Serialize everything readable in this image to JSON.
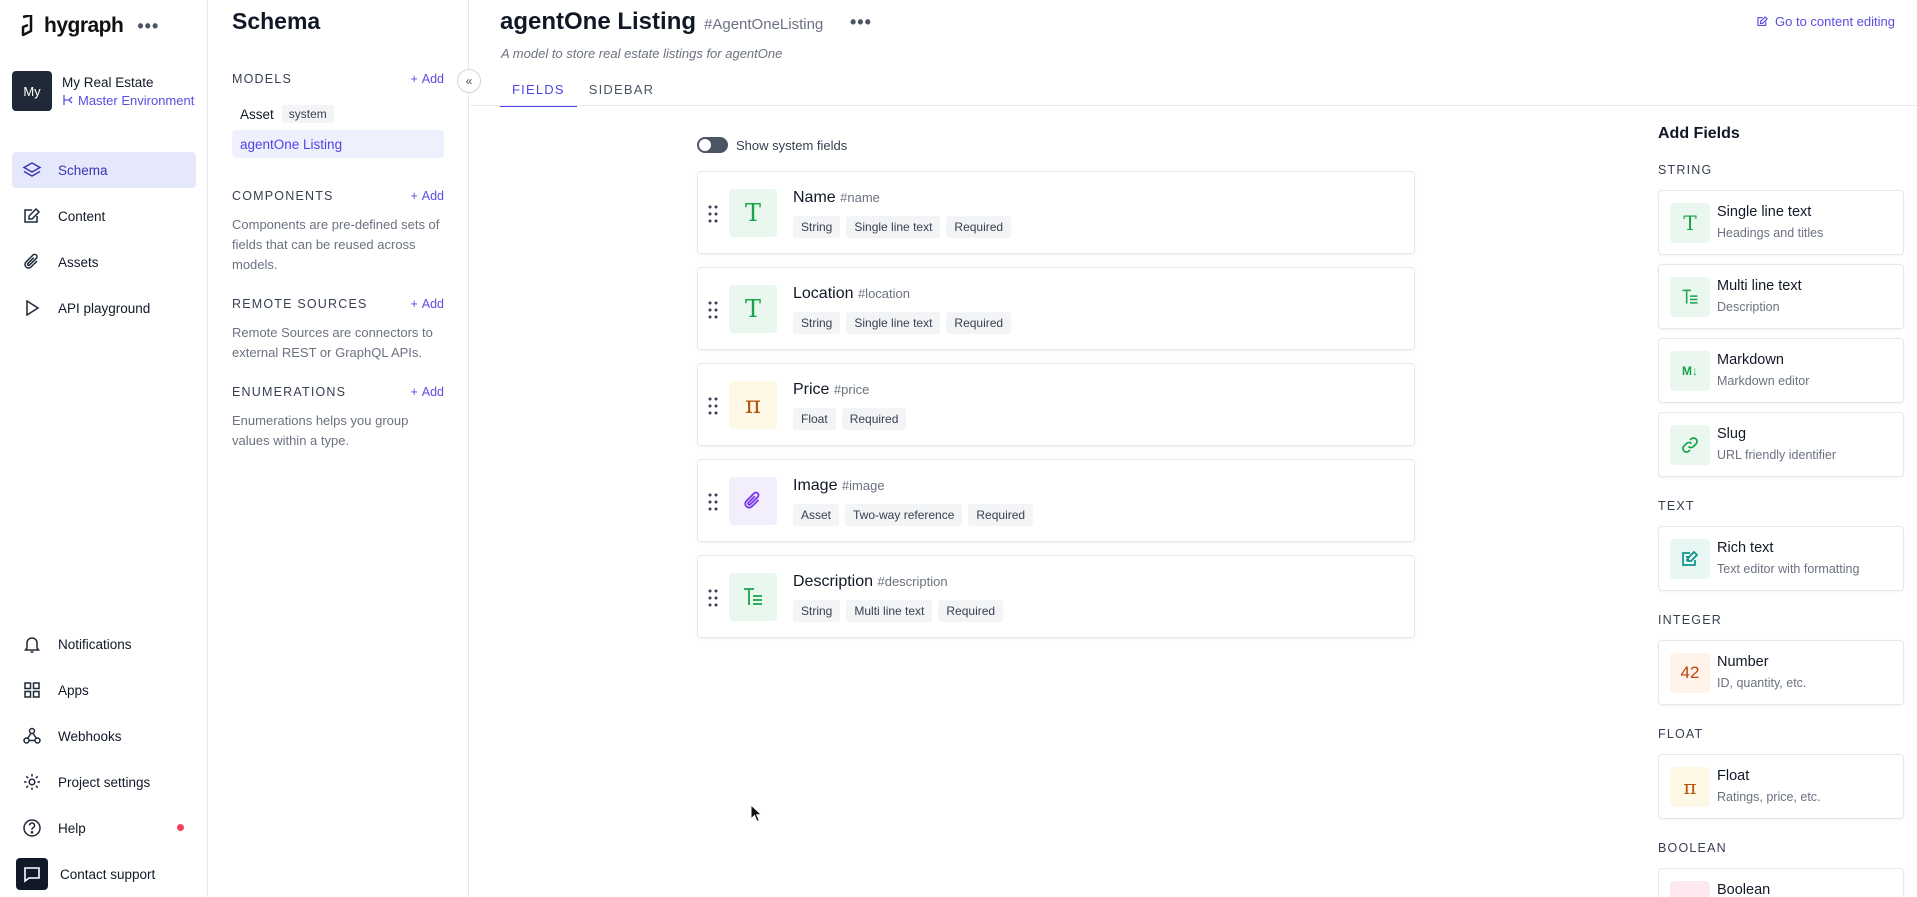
{
  "brand": {
    "name": "hygraph",
    "more": "•••"
  },
  "project": {
    "avatar": "My",
    "name": "My Real Estate",
    "environment": "Master Environment"
  },
  "nav": {
    "top": [
      {
        "label": "Schema",
        "icon": "layers-icon",
        "active": true
      },
      {
        "label": "Content",
        "icon": "edit-icon"
      },
      {
        "label": "Assets",
        "icon": "paperclip-icon"
      },
      {
        "label": "API playground",
        "icon": "play-icon"
      }
    ],
    "bottom": [
      {
        "label": "Notifications",
        "icon": "bell-icon"
      },
      {
        "label": "Apps",
        "icon": "apps-icon"
      },
      {
        "label": "Webhooks",
        "icon": "webhook-icon"
      },
      {
        "label": "Project settings",
        "icon": "gear-icon"
      },
      {
        "label": "Help",
        "icon": "help-icon"
      },
      {
        "label": "Contact support",
        "icon": "chat-icon"
      }
    ]
  },
  "schema_panel": {
    "title": "Schema",
    "add_label": "Add",
    "models_label": "MODELS",
    "models": [
      {
        "name": "Asset",
        "badge": "system"
      },
      {
        "name": "agentOne Listing",
        "active": true
      }
    ],
    "components_label": "COMPONENTS",
    "components_desc": "Components are pre-defined sets of fields that can be reused across models.",
    "remote_label": "REMOTE SOURCES",
    "remote_desc": "Remote Sources are connectors to external REST or GraphQL APIs.",
    "enums_label": "ENUMERATIONS",
    "enums_desc": "Enumerations helps you group values within a type."
  },
  "main": {
    "title": "agentOne Listing",
    "api_id": "#AgentOneListing",
    "more": "•••",
    "description": "A model to store real estate listings for agentOne",
    "goto_label": "Go to content editing",
    "tabs": [
      "FIELDS",
      "SIDEBAR"
    ],
    "show_system_fields": "Show system fields",
    "fields": [
      {
        "name": "Name",
        "api": "#name",
        "badges": [
          "String",
          "Single line text",
          "Required"
        ],
        "icon": "T",
        "icon_name": "text-icon",
        "color": "green"
      },
      {
        "name": "Location",
        "api": "#location",
        "badges": [
          "String",
          "Single line text",
          "Required"
        ],
        "icon": "T",
        "icon_name": "text-icon",
        "color": "green"
      },
      {
        "name": "Price",
        "api": "#price",
        "badges": [
          "Float",
          "Required"
        ],
        "icon": "π",
        "icon_name": "float-icon",
        "color": "yellow"
      },
      {
        "name": "Image",
        "api": "#image",
        "badges": [
          "Asset",
          "Two-way reference",
          "Required"
        ],
        "icon": "",
        "icon_name": "paperclip-icon",
        "color": "purple"
      },
      {
        "name": "Description",
        "api": "#description",
        "badges": [
          "String",
          "Multi line text",
          "Required"
        ],
        "icon": "",
        "icon_name": "multiline-icon",
        "color": "green"
      }
    ]
  },
  "add_fields": {
    "title": "Add Fields",
    "categories": {
      "string": "STRING",
      "text": "TEXT",
      "integer": "INTEGER",
      "float": "FLOAT",
      "boolean": "BOOLEAN"
    },
    "items": [
      {
        "name": "Single line text",
        "desc": "Headings and titles",
        "icon_name": "text-icon"
      },
      {
        "name": "Multi line text",
        "desc": "Description",
        "icon_name": "multiline-icon"
      },
      {
        "name": "Markdown",
        "desc": "Markdown editor",
        "icon_name": "markdown-icon"
      },
      {
        "name": "Slug",
        "desc": "URL friendly identifier",
        "icon_name": "link-icon"
      },
      {
        "name": "Rich text",
        "desc": "Text editor with formatting",
        "icon_name": "richtext-icon"
      },
      {
        "name": "Number",
        "desc": "ID, quantity, etc.",
        "icon_name": "number-icon",
        "glyph": "42"
      },
      {
        "name": "Float",
        "desc": "Ratings, price, etc.",
        "icon_name": "float-icon",
        "glyph": "π"
      },
      {
        "name": "Boolean",
        "desc": "",
        "icon_name": "boolean-icon"
      }
    ]
  },
  "colors": {
    "accent": "#5b4de0",
    "nav_active_bg": "#e5e7fb",
    "notification_dot": "#f43f5e"
  }
}
